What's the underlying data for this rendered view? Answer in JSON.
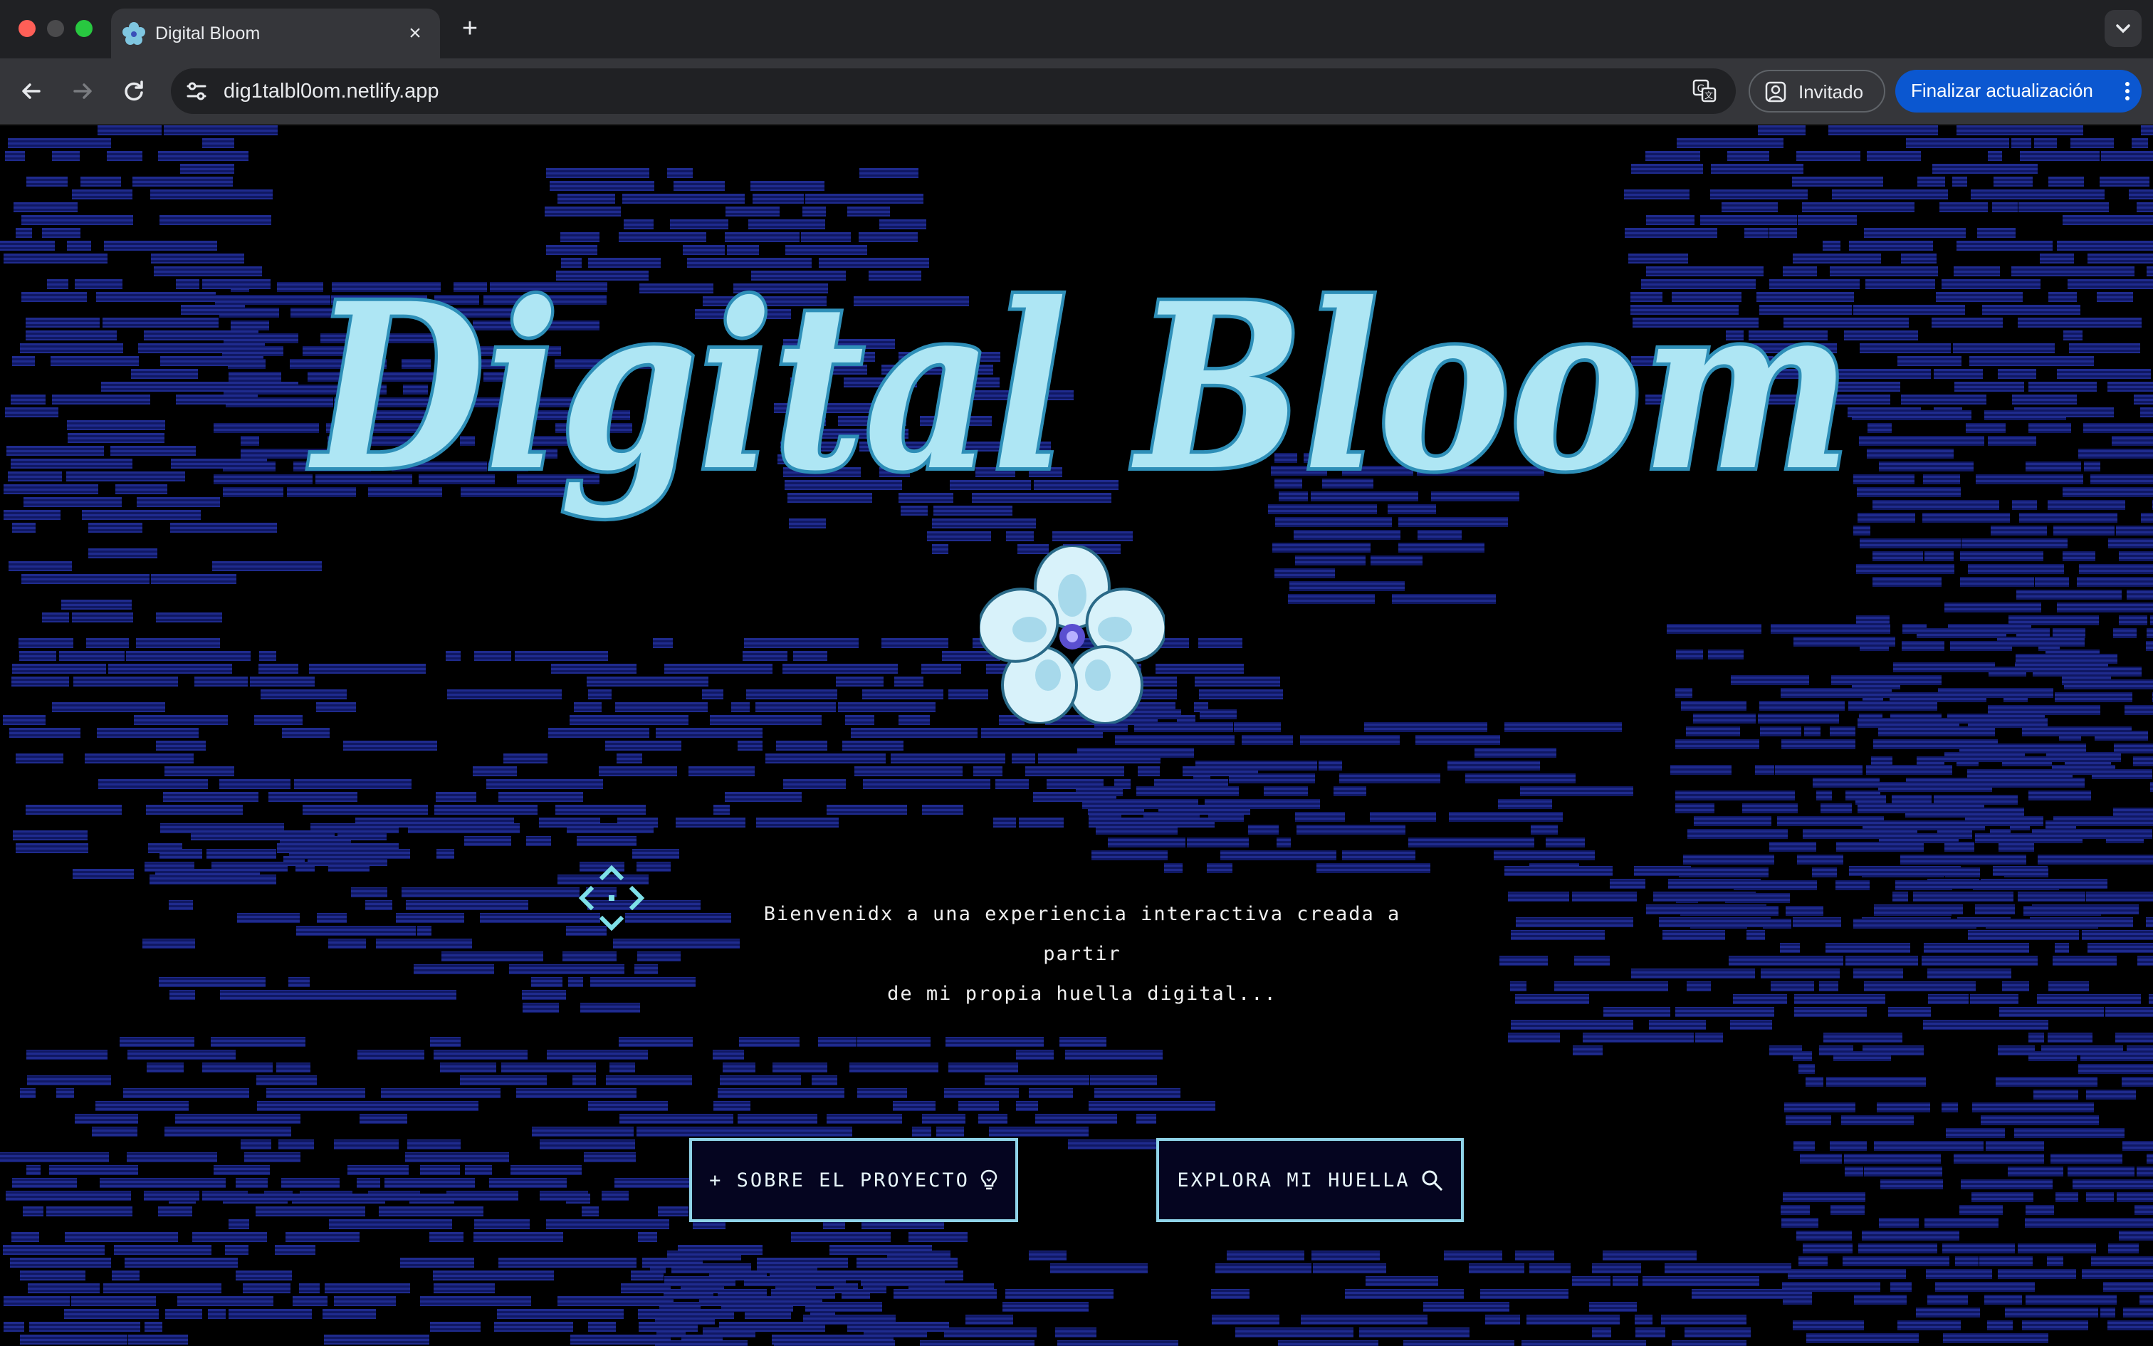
{
  "browser": {
    "tab": {
      "title": "Digital Bloom",
      "favicon": "flower-icon"
    },
    "address_bar": {
      "url": "dig1talbl0om.netlify.app"
    },
    "profile": {
      "label": "Invitado"
    },
    "update_button": {
      "label": "Finalizar actualización"
    }
  },
  "hero": {
    "title": "Digital Bloom",
    "welcome_line1": "Bienvenidx a una experiencia interactiva creada a partir",
    "welcome_line2": "de mi propia huella digital..."
  },
  "buttons": {
    "about": {
      "label": "+ SOBRE EL PROYECTO",
      "icon": "lightbulb-icon"
    },
    "explore": {
      "label": "EXPLORA MI HUELLA",
      "icon": "search-icon"
    }
  },
  "colors": {
    "background": "#000000",
    "pattern": "#1e2a8c",
    "title": "#aee6f4",
    "button_border": "#8fd3e8",
    "update_button": "#0b57d0"
  }
}
